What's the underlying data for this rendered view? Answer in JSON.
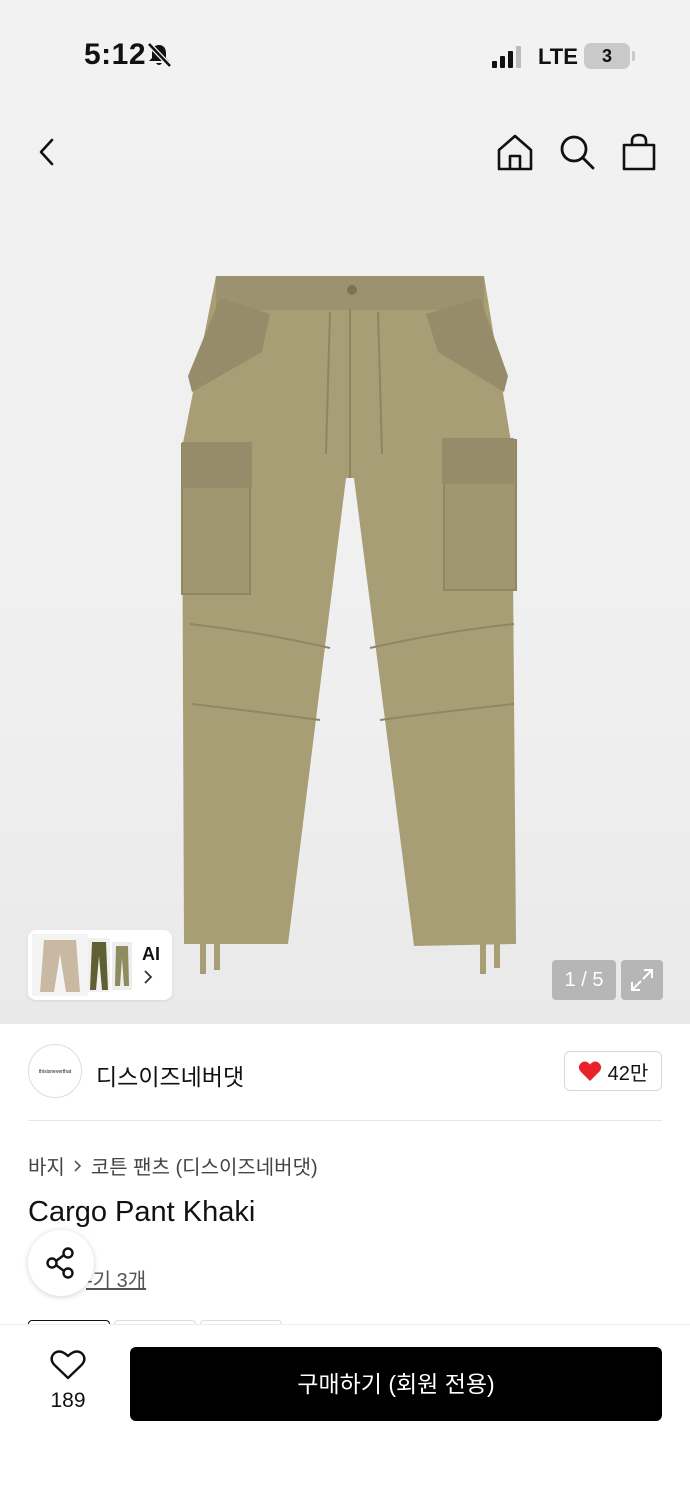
{
  "status_bar": {
    "time": "5:12",
    "network": "LTE",
    "battery": "3"
  },
  "gallery": {
    "counter": "1 / 5",
    "ai_label": "AI"
  },
  "brand": {
    "name": "디스이즈네버댓",
    "logo_text": "thisisneverthat",
    "likes": "42만"
  },
  "product": {
    "breadcrumb": [
      "바지",
      "코튼 팬츠 (디스이즈네버댓)"
    ],
    "title": "Cargo Pant Khaki",
    "review_link": "-기 3개"
  },
  "bottom_bar": {
    "wish_count": "189",
    "buy_label": "구매하기 (회원 전용)"
  },
  "colors": {
    "product_khaki": "#a89e76",
    "like_red": "#e8222c",
    "button_black": "#000000"
  }
}
